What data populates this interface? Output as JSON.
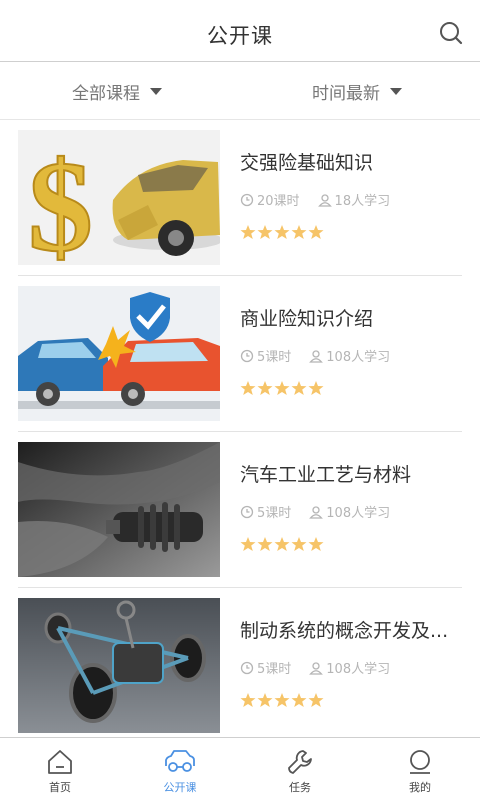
{
  "header": {
    "title": "公开课"
  },
  "filters": {
    "category": "全部课程",
    "sort": "时间最新"
  },
  "courses": [
    {
      "name": "交强险基础知识",
      "hours": "20课时",
      "learners": "18人学习",
      "rating": 5
    },
    {
      "name": "商业险知识介绍",
      "hours": "5课时",
      "learners": "108人学习",
      "rating": 5
    },
    {
      "name": "汽车工业工艺与材料",
      "hours": "5课时",
      "learners": "108人学习",
      "rating": 5
    },
    {
      "name": "制动系统的概念开发及...",
      "hours": "5课时",
      "learners": "108人学习",
      "rating": 5
    }
  ],
  "tabs": [
    {
      "label": "首页",
      "icon": "home-icon"
    },
    {
      "label": "公开课",
      "icon": "car-icon",
      "active": true
    },
    {
      "label": "任务",
      "icon": "wrench-icon"
    },
    {
      "label": "我的",
      "icon": "user-icon"
    }
  ],
  "colors": {
    "accent": "#4a90e2",
    "star": "#f6c468",
    "meta": "#b5b5b5"
  }
}
